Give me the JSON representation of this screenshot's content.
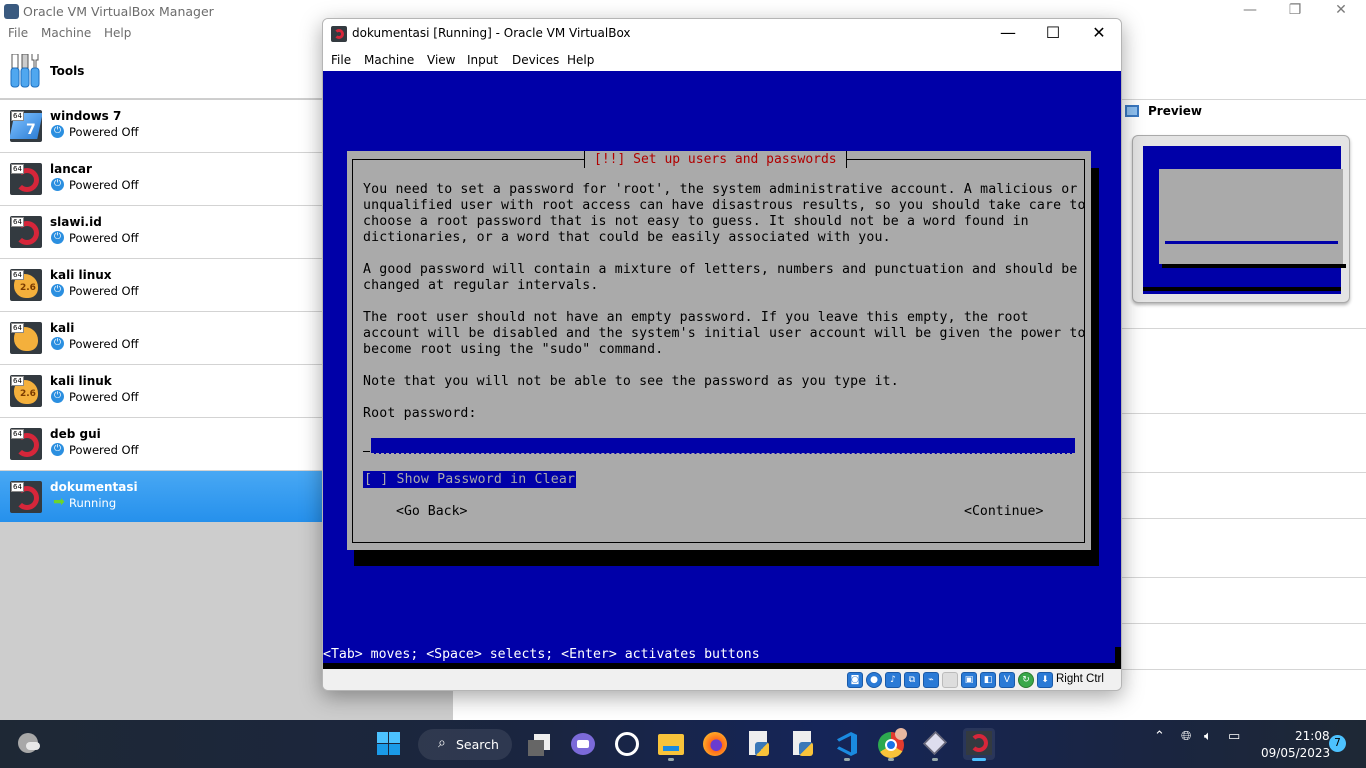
{
  "manager": {
    "title": "Oracle VM VirtualBox Manager",
    "menu": [
      "File",
      "Machine",
      "Help"
    ],
    "window_controls": {
      "minimize": "—",
      "restore": "❐",
      "close": "✕"
    },
    "tools_label": "Tools",
    "vms": [
      {
        "name": "windows 7",
        "status": "Powered Off",
        "os": "windows",
        "arch_badge": "64",
        "version_badge": "7"
      },
      {
        "name": "lancar",
        "status": "Powered Off",
        "os": "debian",
        "arch_badge": "64"
      },
      {
        "name": "slawi.id",
        "status": "Powered Off",
        "os": "debian",
        "arch_badge": "64"
      },
      {
        "name": "kali linux",
        "status": "Powered Off",
        "os": "kali",
        "arch_badge": "64",
        "version_badge": "2.6"
      },
      {
        "name": "kali",
        "status": "Powered Off",
        "os": "kali",
        "arch_badge": "64"
      },
      {
        "name": "kali linuk",
        "status": "Powered Off",
        "os": "kali",
        "arch_badge": "64",
        "version_badge": "2.6"
      },
      {
        "name": "deb gui",
        "status": "Powered Off",
        "os": "debian",
        "arch_badge": "64"
      },
      {
        "name": "dokumentasi",
        "status": "Running",
        "os": "debian",
        "arch_badge": "64",
        "selected": true
      }
    ],
    "preview_title": "Preview",
    "selection_color": "#2f9af0"
  },
  "vm_window": {
    "title": "dokumentasi [Running] - Oracle VM VirtualBox",
    "menu": [
      "File",
      "Machine",
      "View",
      "Input",
      "Devices",
      "Help"
    ],
    "window_controls": {
      "minimize": "—",
      "maximize": "☐",
      "close": "✕"
    },
    "host_key": "Right Ctrl",
    "status_icons": [
      "hard-disk-icon",
      "optical-drive-icon",
      "audio-icon",
      "network-icon",
      "usb-icon",
      "shared-folder-icon",
      "display-icon",
      "capture-icon",
      "cpu-icon",
      "guest-additions-icon",
      "mouse-integration-icon"
    ]
  },
  "installer": {
    "dialog_title": "[!!] Set up users and passwords",
    "paragraph_1": "You need to set a password for 'root', the system administrative account. A malicious or\nunqualified user with root access can have disastrous results, so you should take care to\nchoose a root password that is not easy to guess. It should not be a word found in\ndictionaries, or a word that could be easily associated with you.",
    "paragraph_2": "A good password will contain a mixture of letters, numbers and punctuation and should be\nchanged at regular intervals.",
    "paragraph_3": "The root user should not have an empty password. If you leave this empty, the root\naccount will be disabled and the system's initial user account will be given the power to\nbecome root using the \"sudo\" command.",
    "paragraph_4": "Note that you will not be able to see the password as you type it.",
    "field_label": "Root password:",
    "password_value": "",
    "show_password_checkbox": "[ ] Show Password in Clear",
    "go_back": "<Go Back>",
    "continue": "<Continue>",
    "hint": "<Tab> moves; <Space> selects; <Enter> activates buttons",
    "colors": {
      "background": "#0000a8",
      "dialog": "#aaaaaa",
      "title": "#b00000"
    }
  },
  "taskbar": {
    "search_label": "Search",
    "apps": [
      "widgets",
      "start",
      "task-view",
      "teams-chat",
      "app-icon",
      "file-explorer",
      "firefox",
      "python-file-1",
      "python-file-2",
      "vscode",
      "chrome",
      "virtualbox",
      "dokumentasi-vm"
    ],
    "time": "21:08",
    "date": "09/05/2023",
    "notification_count": "7"
  }
}
